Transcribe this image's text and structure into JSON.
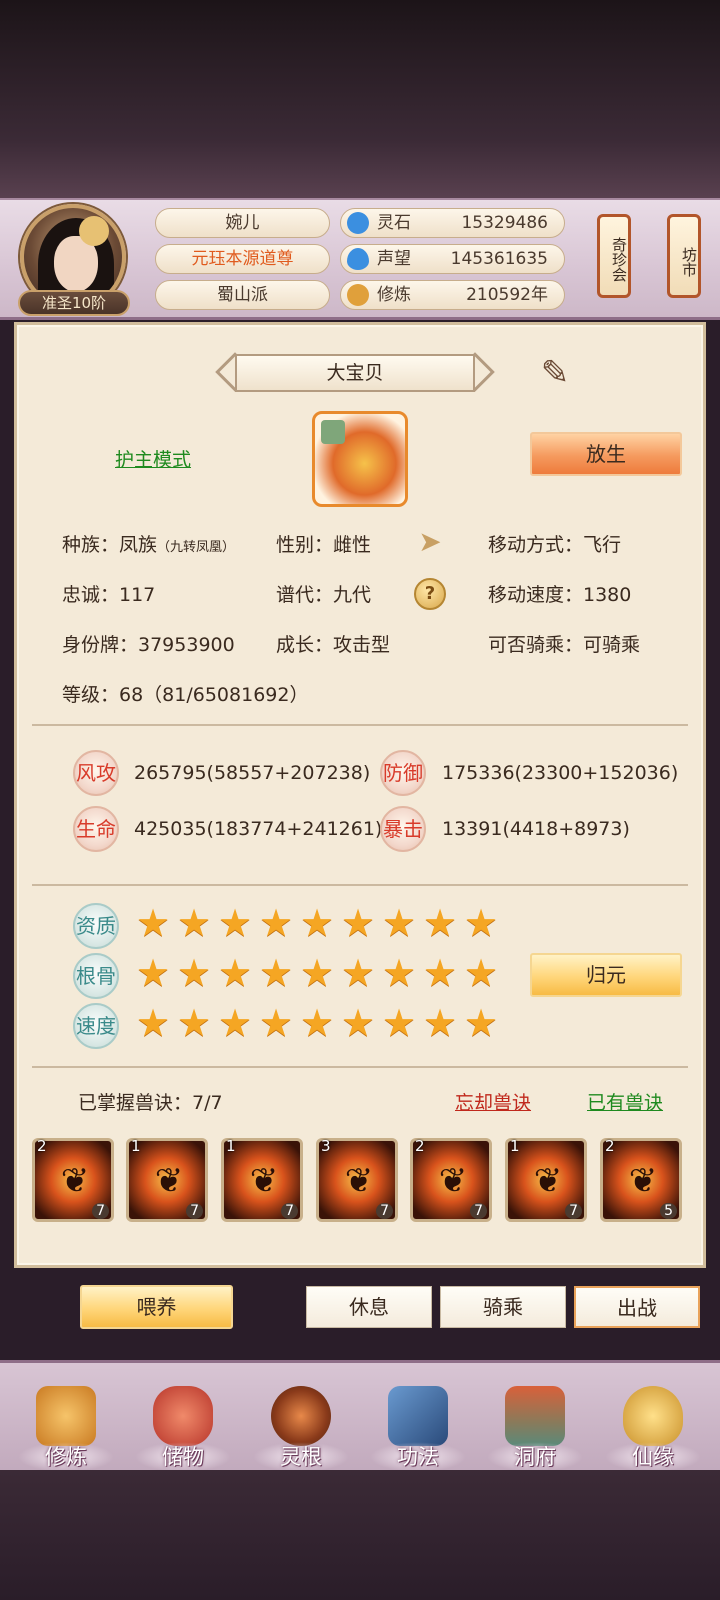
{
  "player": {
    "name": "婉儿",
    "title": "元珏本源道尊",
    "sect": "蜀山派",
    "rank": "准圣10阶"
  },
  "resources": [
    {
      "label": "灵石",
      "value": "15329486",
      "icon": "spirit-stone-icon",
      "color": "#3b8fe0"
    },
    {
      "label": "声望",
      "value": "145361635",
      "icon": "prestige-icon",
      "color": "#3b8fe0"
    },
    {
      "label": "修炼",
      "value": "210592年",
      "icon": "cultivation-icon",
      "color": "#e0a03b"
    }
  ],
  "side_buttons": {
    "treasure": "奇珍会",
    "market": "坊市"
  },
  "pet": {
    "name": "大宝贝",
    "mode_link": "护主模式",
    "release_button": "放生",
    "race_label": "种族：凤族",
    "race_sub": "（九转凤凰）",
    "gender": "性别：雌性",
    "move_type": "移动方式：飞行",
    "loyalty": "忠诚：117",
    "generation": "谱代：九代",
    "move_speed": "移动速度：1380",
    "id_tag": "身份牌：37953900",
    "growth": "成长：攻击型",
    "rideable": "可否骑乘：可骑乘",
    "level": "等级：68（81/65081692）"
  },
  "attributes": [
    {
      "badge": "风攻",
      "value": "265795(58557+207238)"
    },
    {
      "badge": "防御",
      "value": "175336(23300+152036)"
    },
    {
      "badge": "生命",
      "value": "425035(183774+241261)"
    },
    {
      "badge": "暴击",
      "value": "13391(4418+8973)"
    }
  ],
  "quality_rows": [
    {
      "badge": "资质",
      "stars": 9
    },
    {
      "badge": "根骨",
      "stars": 9
    },
    {
      "badge": "速度",
      "stars": 9
    }
  ],
  "restore_button": "归元",
  "skills": {
    "mastered": "已掌握兽诀：7/7",
    "forget_link": "忘却兽诀",
    "owned_link": "已有兽诀",
    "cards": [
      {
        "level": "2",
        "count": "7"
      },
      {
        "level": "1",
        "count": "7"
      },
      {
        "level": "1",
        "count": "7"
      },
      {
        "level": "3",
        "count": "7"
      },
      {
        "level": "2",
        "count": "7"
      },
      {
        "level": "1",
        "count": "7"
      },
      {
        "level": "2",
        "count": "5"
      }
    ]
  },
  "actions": {
    "feed": "喂养",
    "rest": "休息",
    "ride": "骑乘",
    "battle": "出战"
  },
  "nav": [
    {
      "label": "修炼",
      "icon": "cultivation-hood-icon",
      "color": "#e0902a"
    },
    {
      "label": "储物",
      "icon": "storage-bag-icon",
      "color": "#d04a3a"
    },
    {
      "label": "灵根",
      "icon": "spirit-root-icon",
      "color": "#a5502a"
    },
    {
      "label": "功法",
      "icon": "technique-book-icon",
      "color": "#3a6aa0"
    },
    {
      "label": "洞府",
      "icon": "cave-dwelling-icon",
      "color": "#b04a3a"
    },
    {
      "label": "仙缘",
      "icon": "immortal-fate-icon",
      "color": "#d4a03a"
    }
  ]
}
